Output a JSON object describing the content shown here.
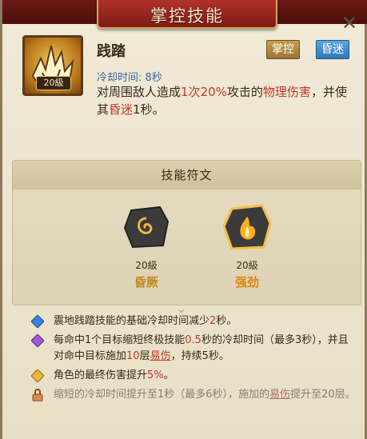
{
  "header": {
    "title": "掌控技能"
  },
  "skill": {
    "name": "践踏",
    "level": "20級",
    "tags": [
      "掌控",
      "昏迷"
    ],
    "cooldown": "冷却时间: 8秒",
    "desc_pre": "对周围敌人造成",
    "desc_count": "1次",
    "desc_pct": "20%",
    "desc_mid": "攻击的",
    "desc_dmg": "物理伤害",
    "desc_mid2": "，并使其",
    "desc_stun": "昏迷",
    "desc_post": "1秒。"
  },
  "runes": {
    "title": "技能符文",
    "items": [
      {
        "level": "20級",
        "name": "昏厥",
        "icon": "swirl-icon"
      },
      {
        "level": "20級",
        "name": "强劲",
        "icon": "flame-icon"
      }
    ]
  },
  "effects": [
    {
      "icon": "blue-diamond-icon",
      "pre": "震地践踏技能的基础冷却时间减少",
      "num": "2",
      "post": "秒。"
    },
    {
      "icon": "purple-diamond-icon",
      "pre": "每命中1个目标缩短终极技能",
      "num": "0.5",
      "mid": "秒的冷却时间（最多3秒），并且对命中目标施加",
      "num2": "10",
      "mid2": "层",
      "link": "易伤",
      "post": "，持续5秒。"
    },
    {
      "icon": "gold-diamond-icon",
      "pre": "角色的最终伤害提升",
      "num": "5%",
      "post": "。"
    },
    {
      "icon": "lock-icon",
      "pre": "缩短的冷却时间提升至1秒（最多6秒），施加的",
      "link": "易伤",
      "post": "提升至20层。"
    }
  ],
  "colors": {
    "accent_red": "#c0392b",
    "stun_blue": "#2f78b8",
    "gold": "#c59d4f"
  }
}
